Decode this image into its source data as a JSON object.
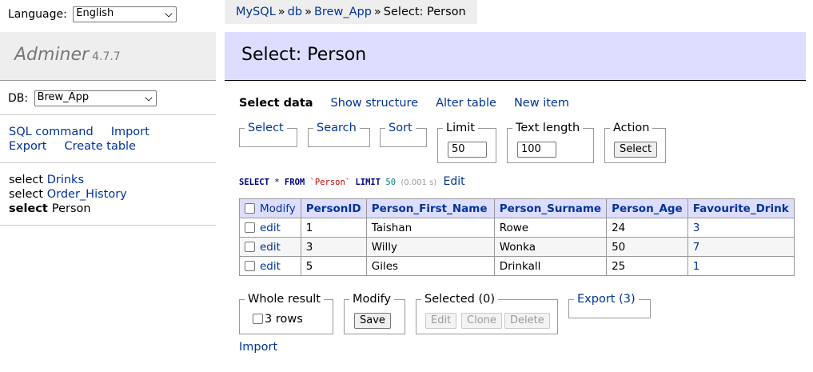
{
  "language": {
    "label": "Language:",
    "value": "English"
  },
  "breadcrumb": [
    "MySQL",
    "db",
    "Brew_App",
    "Select: Person"
  ],
  "sidebar": {
    "app_name": "Adminer",
    "version": "4.7.7",
    "db_label": "DB:",
    "db_value": "Brew_App",
    "links": {
      "sql_command": "SQL command",
      "import": "Import",
      "export": "Export",
      "create_table": "Create table"
    },
    "tables": [
      {
        "action": "select",
        "name": "Drinks"
      },
      {
        "action": "select",
        "name": "Order_History"
      },
      {
        "action": "select",
        "name": "Person"
      }
    ]
  },
  "page": {
    "title": "Select: Person"
  },
  "menu": {
    "select_data": "Select data",
    "show_structure": "Show structure",
    "alter_table": "Alter table",
    "new_item": "New item"
  },
  "filters": {
    "select": "Select",
    "search": "Search",
    "sort": "Sort",
    "limit_label": "Limit",
    "limit_value": "50",
    "text_length_label": "Text length",
    "text_length_value": "100",
    "action_label": "Action",
    "action_button": "Select"
  },
  "sql": {
    "select": "SELECT",
    "star": "*",
    "from": "FROM",
    "table": "`Person`",
    "limit": "LIMIT",
    "limit_value": "50",
    "time": "(0.001 s)",
    "edit": "Edit"
  },
  "table": {
    "modify": "Modify",
    "columns": [
      "PersonID",
      "Person_First_Name",
      "Person_Surname",
      "Person_Age",
      "Favourite_Drink"
    ],
    "edit_label": "edit",
    "rows": [
      [
        "1",
        "Taishan",
        "Rowe",
        "24",
        "3"
      ],
      [
        "3",
        "Willy",
        "Wonka",
        "50",
        "7"
      ],
      [
        "5",
        "Giles",
        "Drinkall",
        "25",
        "1"
      ]
    ]
  },
  "bottom": {
    "whole_result": "Whole result",
    "rows_label": "3 rows",
    "modify": "Modify",
    "save": "Save",
    "selected": "Selected (0)",
    "edit": "Edit",
    "clone": "Clone",
    "delete": "Delete",
    "export": "Export (3)",
    "import": "Import"
  }
}
